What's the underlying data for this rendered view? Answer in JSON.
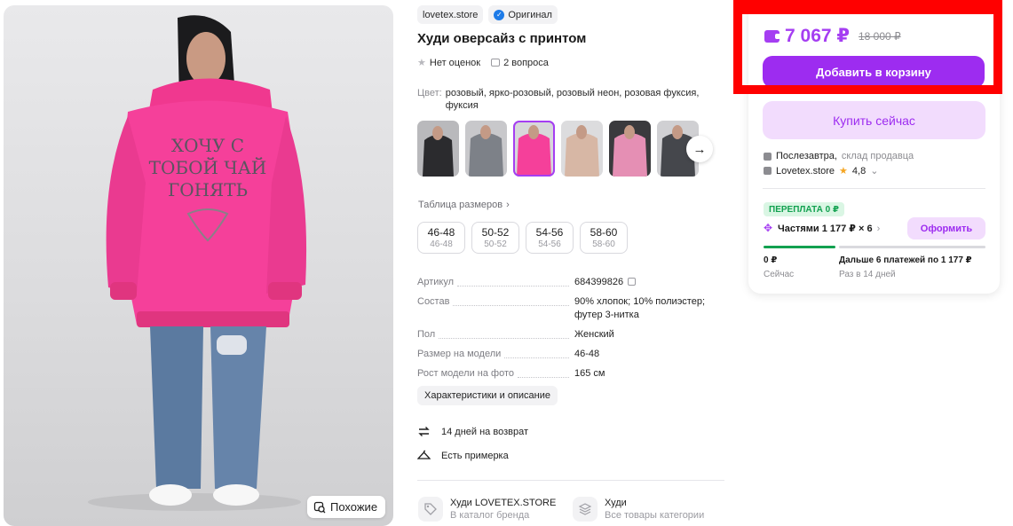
{
  "product": {
    "brand_chip": "lovetex.store",
    "original_chip": "Оригинал",
    "title": "Худи оверсайз с принтом",
    "rating_text": "Нет оценок",
    "questions_text": "2 вопроса",
    "color_label": "Цвет:",
    "color_value": "розовый, ярко-розовый, розовый неон, розовая фуксия, фуксия",
    "size_table_link": "Таблица размеров",
    "sizes": [
      {
        "main": "46-48",
        "sub": "46-48"
      },
      {
        "main": "50-52",
        "sub": "50-52"
      },
      {
        "main": "54-56",
        "sub": "54-56"
      },
      {
        "main": "58-60",
        "sub": "58-60"
      }
    ],
    "specs": [
      {
        "key": "Артикул",
        "value": "684399826"
      },
      {
        "key": "Состав",
        "value": "90% хлопок; 10% полиэстер; футер 3-нитка"
      },
      {
        "key": "Пол",
        "value": "Женский"
      },
      {
        "key": "Размер на модели",
        "value": "46-48"
      },
      {
        "key": "Рост модели на фото",
        "value": "165 см"
      }
    ],
    "characteristics_button": "Характеристики и описание",
    "return_text": "14 дней на возврат",
    "fitting_text": "Есть примерка",
    "similar_button": "Похожие",
    "brand_catalog": {
      "title": "Худи LOVETEX.STORE",
      "subtitle": "В каталог бренда"
    },
    "category": {
      "title": "Худи",
      "subtitle": "Все товары категории"
    }
  },
  "buy_panel": {
    "price": "7 067 ₽",
    "old_price": "18 000 ₽",
    "add_to_cart": "Добавить в корзину",
    "buy_now": "Купить сейчас",
    "delivery_when": "Послезавтра,",
    "delivery_where": "склад продавца",
    "seller": "Lovetex.store",
    "seller_rating": "4,8",
    "overpay_badge": "ПЕРЕПЛАТА 0 ₽",
    "installments": "Частями 1 177 ₽ × 6",
    "arrange_button": "Оформить",
    "now_amount": "0 ₽",
    "now_label": "Сейчас",
    "later_amount": "Дальше 6 платежей по 1 177 ₽",
    "later_label": "Раз в 14 дней"
  },
  "colors": {
    "accent": "#a53ef2",
    "button": "#9d2cf0",
    "light_accent": "#f2dcfd",
    "highlight": "#ff0000",
    "green": "#12a150"
  }
}
